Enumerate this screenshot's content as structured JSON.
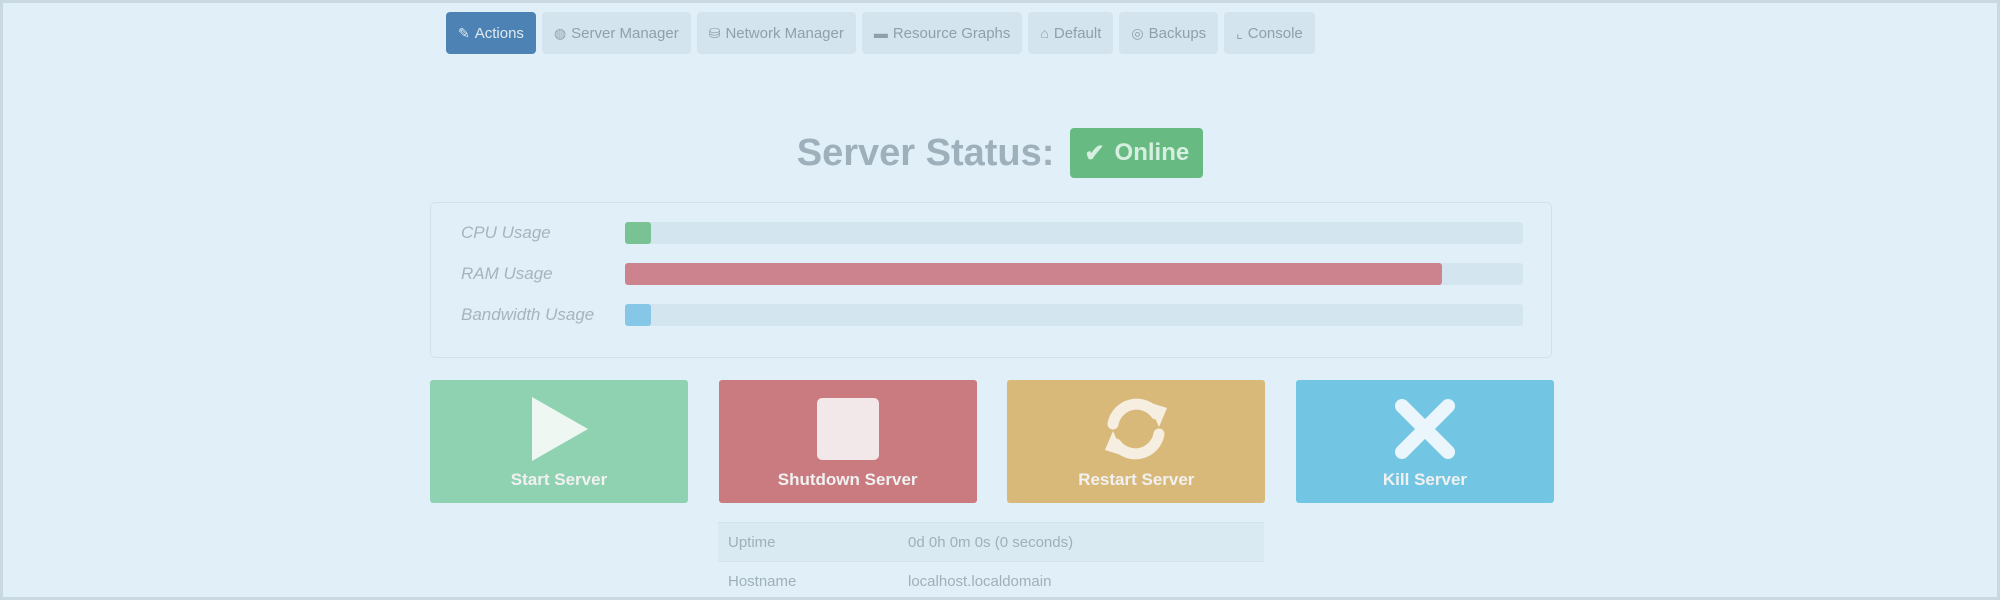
{
  "tabs": [
    {
      "icon": "pencil-icon",
      "glyph": "✎",
      "label": "Actions",
      "active": true
    },
    {
      "icon": "globe-icon",
      "glyph": "◍",
      "label": "Server Manager",
      "active": false
    },
    {
      "icon": "network-icon",
      "glyph": "⛁",
      "label": "Network Manager",
      "active": false
    },
    {
      "icon": "folder-icon",
      "glyph": "▬",
      "label": "Resource Graphs",
      "active": false
    },
    {
      "icon": "home-icon",
      "glyph": "⌂",
      "label": "Default",
      "active": false
    },
    {
      "icon": "backup-icon",
      "glyph": "◎",
      "label": "Backups",
      "active": false
    },
    {
      "icon": "console-icon",
      "glyph": "⌞",
      "label": "Console",
      "active": false
    }
  ],
  "status": {
    "label": "Server Status:",
    "badge": "Online",
    "badge_color": "#67bb82"
  },
  "usage": [
    {
      "label": "CPU Usage",
      "percent": 3,
      "color": "#79c294"
    },
    {
      "label": "RAM Usage",
      "percent": 91,
      "color": "#cd838d"
    },
    {
      "label": "Bandwidth Usage",
      "percent": 3,
      "color": "#86c6e6"
    }
  ],
  "actions": [
    {
      "label": "Start Server",
      "icon": "play-icon",
      "color": "#8fd2b2"
    },
    {
      "label": "Shutdown Server",
      "icon": "stop-icon",
      "color": "#c97b80"
    },
    {
      "label": "Restart Server",
      "icon": "refresh-icon",
      "color": "#d8b97a"
    },
    {
      "label": "Kill Server",
      "icon": "close-icon",
      "color": "#72c6e3"
    }
  ],
  "info": [
    {
      "key": "Uptime",
      "value": "0d 0h 0m 0s (0 seconds)"
    },
    {
      "key": "Hostname",
      "value": "localhost.localdomain"
    }
  ]
}
